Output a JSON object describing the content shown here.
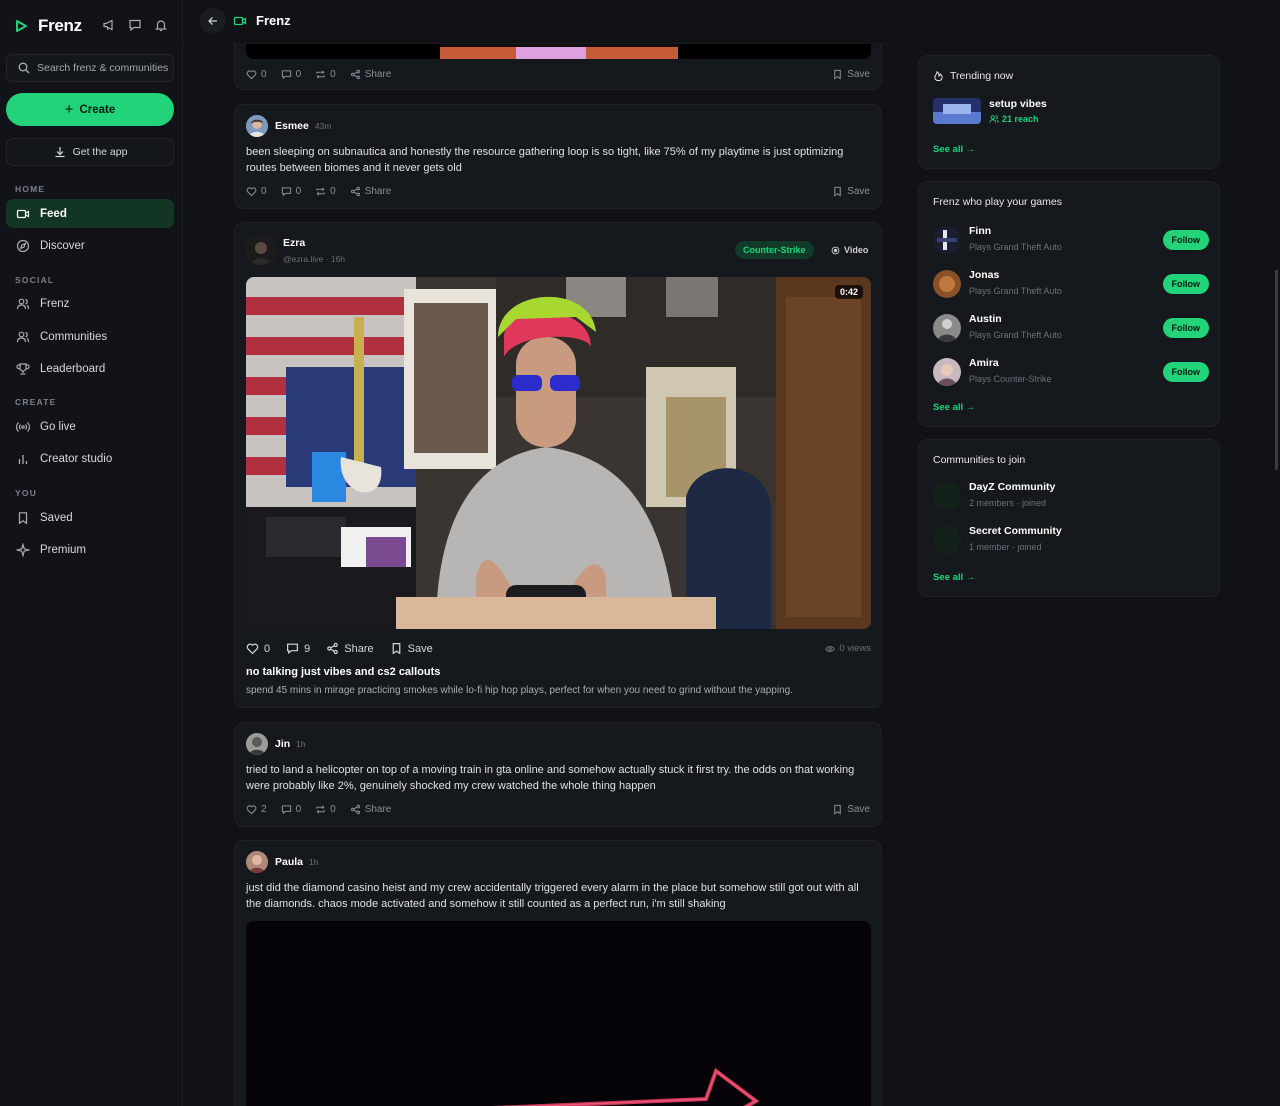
{
  "app": {
    "name": "Frenz",
    "accent": "#22d37a"
  },
  "sidebar": {
    "search_placeholder": "Search frenz & communities",
    "create_label": "Create",
    "get_app_label": "Get the app",
    "sections": {
      "home": "HOME",
      "social": "SOCIAL",
      "create": "CREATE",
      "you": "YOU"
    },
    "items": [
      {
        "label": "Feed",
        "icon": "video-icon",
        "active": true
      },
      {
        "label": "Discover",
        "icon": "compass-icon"
      },
      {
        "label": "Frenz",
        "icon": "users-icon"
      },
      {
        "label": "Communities",
        "icon": "users-icon"
      },
      {
        "label": "Leaderboard",
        "icon": "trophy-icon"
      },
      {
        "label": "Go live",
        "icon": "broadcast-icon"
      },
      {
        "label": "Creator studio",
        "icon": "bar-chart-icon"
      },
      {
        "label": "Saved",
        "icon": "bookmark-icon"
      },
      {
        "label": "Premium",
        "icon": "sparkle-icon"
      }
    ]
  },
  "topbar": {
    "title": "Frenz"
  },
  "feed": {
    "top_partial": {
      "likes": "0",
      "comments": "0",
      "reposts": "0",
      "share": "Share",
      "save": "Save"
    },
    "posts": [
      {
        "author": "Esmee",
        "ago": "43m",
        "text": "been sleeping on subnautica and honestly the resource gathering loop is so tight, like 75% of my playtime is just optimizing routes between biomes and it never gets old",
        "likes": "0",
        "comments": "0",
        "reposts": "0",
        "share": "Share",
        "save": "Save"
      },
      {
        "author": "Ezra",
        "handle": "@ezra.live · 16h",
        "game_tag": "Counter-Strike",
        "media_tag": "Video",
        "duration": "0:42",
        "likes": "0",
        "comments": "9",
        "share": "Share",
        "save": "Save",
        "views": "0 views",
        "title": "no talking just vibes and cs2 callouts",
        "description": "spend 45 mins in mirage practicing smokes while lo-fi hip hop plays, perfect for when you need to grind without the yapping."
      },
      {
        "author": "Jin",
        "ago": "1h",
        "text": "tried to land a helicopter on top of a moving train in gta online and somehow actually stuck it first try. the odds on that working were probably like 2%, genuinely shocked my crew watched the whole thing happen",
        "likes": "2",
        "comments": "0",
        "reposts": "0",
        "share": "Share",
        "save": "Save"
      },
      {
        "author": "Paula",
        "ago": "1h",
        "text": "just did the diamond casino heist and my crew accidentally triggered every alarm in the place but somehow still got out with all the diamonds. chaos mode activated and somehow it still counted as a perfect run, i'm still shaking"
      }
    ]
  },
  "trending": {
    "title": "Trending now",
    "item_name": "setup vibes",
    "item_reach": "21 reach",
    "see_all": "See all →"
  },
  "frenz_panel": {
    "title": "Frenz who play your games",
    "follow_label": "Follow",
    "people": [
      {
        "name": "Finn",
        "game": "Plays Grand Theft Auto"
      },
      {
        "name": "Jonas",
        "game": "Plays Grand Theft Auto"
      },
      {
        "name": "Austin",
        "game": "Plays Grand Theft Auto"
      },
      {
        "name": "Amira",
        "game": "Plays Counter-Strike"
      }
    ],
    "see_all": "See all →"
  },
  "communities_panel": {
    "title": "Communities to join",
    "items": [
      {
        "name": "DayZ Community",
        "meta": "2 members · joined"
      },
      {
        "name": "Secret Community",
        "meta": "1 member · joined"
      }
    ],
    "see_all": "See all →"
  }
}
